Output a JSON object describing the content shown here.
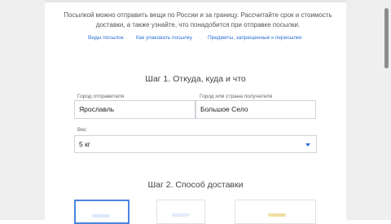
{
  "intro": {
    "text": "Посылкой можно отправить вещи по России и за границу. Рассчитайте срок и стоимость доставки, а также узнайте, что понадобится при отправке посылки."
  },
  "links": [
    "Виды посылок",
    "Как упаковать посылку",
    "Предметы, запрещенные к пересылке"
  ],
  "step1": {
    "title": "Шаг 1. Откуда, куда и что",
    "from": {
      "label": "Город отправителя",
      "value": "Ярославль"
    },
    "to": {
      "label": "Город или страна получателя",
      "value": "Большое Село"
    },
    "weight": {
      "label": "Вес",
      "value": "5 кг"
    }
  },
  "step2": {
    "title": "Шаг 2. Способ доставки"
  },
  "colors": {
    "accent": "#2f6fd6",
    "selected_border": "#4a85e0",
    "side_bg": "#eeeeee"
  }
}
